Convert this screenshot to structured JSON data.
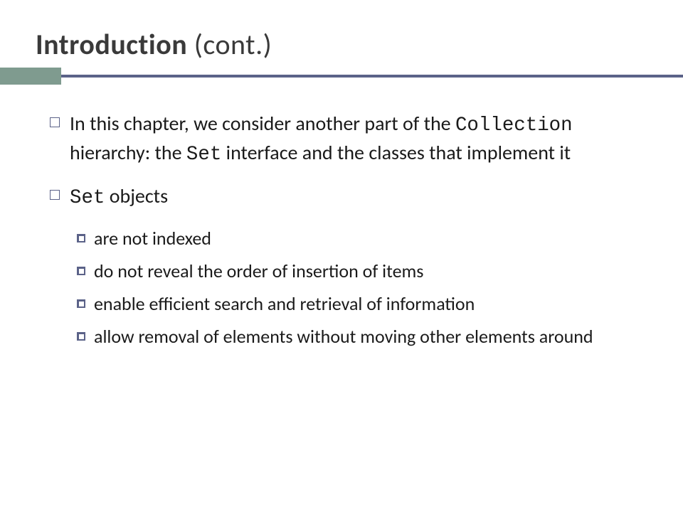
{
  "title": {
    "bold": "Introduction ",
    "light": "(cont.)"
  },
  "bullets": [
    {
      "parts": [
        {
          "t": "In this chapter, we consider another part of the ",
          "mono": false
        },
        {
          "t": "Collection",
          "mono": true
        },
        {
          "t": " hierarchy: the ",
          "mono": false
        },
        {
          "t": "Set",
          "mono": true
        },
        {
          "t": " interface and the classes that implement it",
          "mono": false
        }
      ]
    },
    {
      "parts": [
        {
          "t": "Set",
          "mono": true
        },
        {
          "t": " objects",
          "mono": false
        }
      ]
    }
  ],
  "subbullets": [
    "are not indexed",
    "do not reveal the order of insertion of items",
    "enable efficient search and retrieval of information",
    "allow removal of elements without moving other elements around"
  ]
}
